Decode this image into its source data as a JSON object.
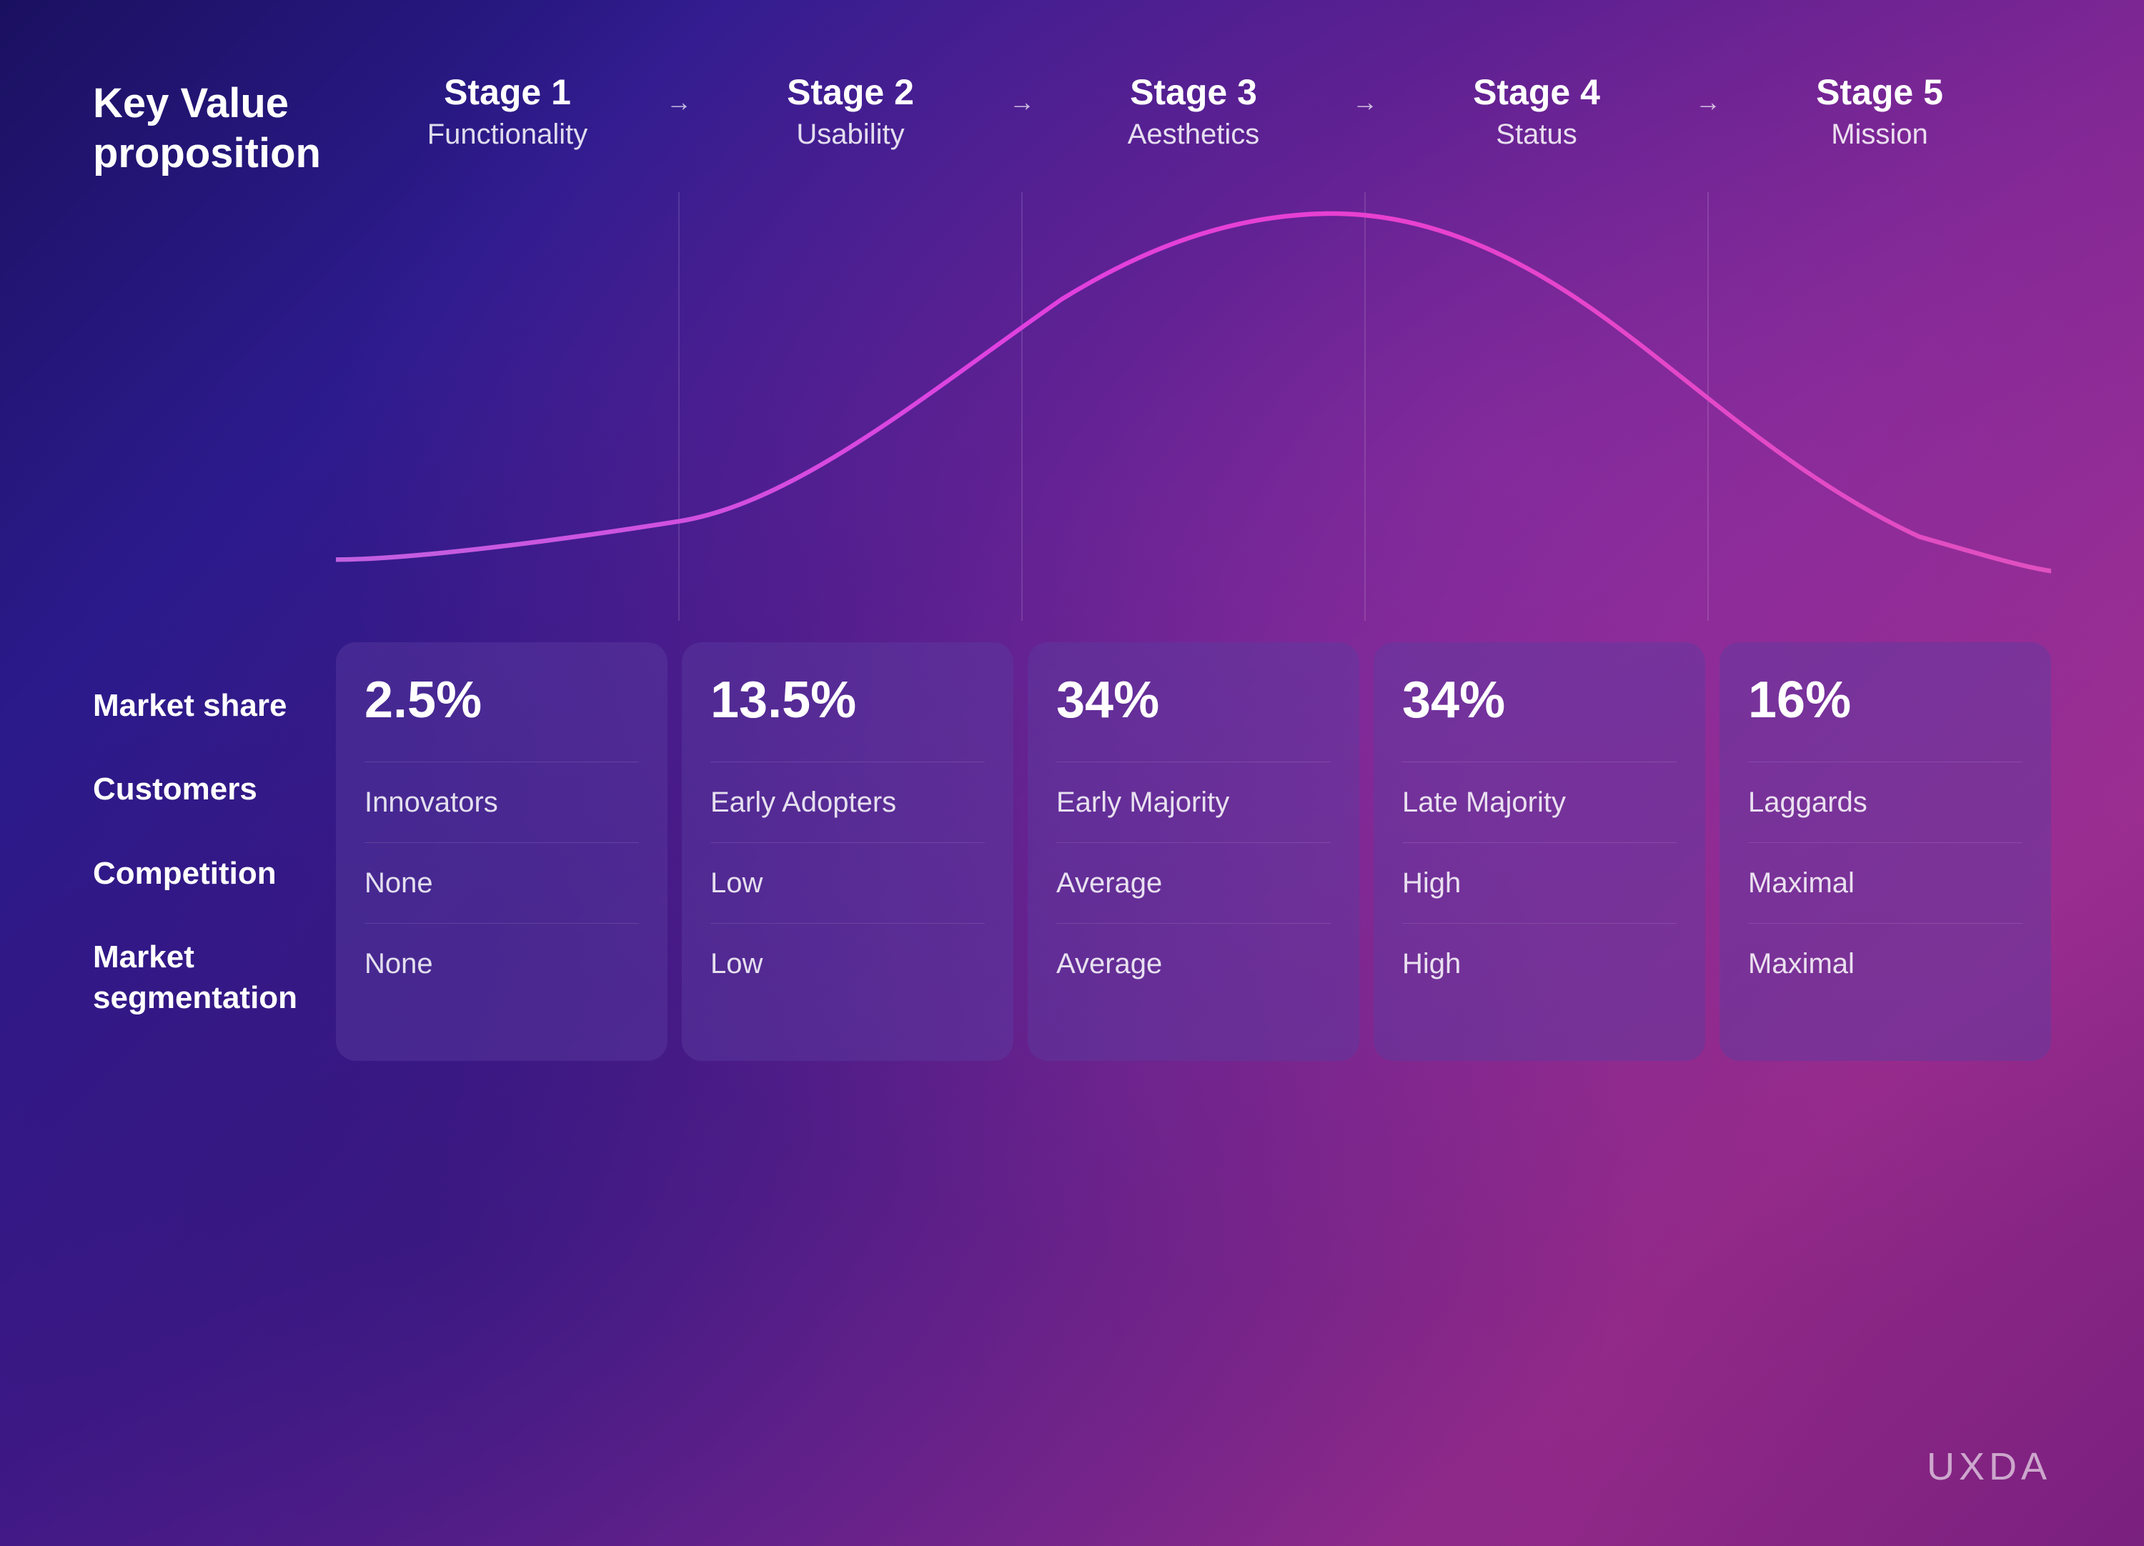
{
  "title": "Key Value proposition",
  "stages": [
    {
      "number": "Stage 1",
      "subtitle": "Functionality",
      "arrow": true
    },
    {
      "number": "Stage 2",
      "subtitle": "Usability",
      "arrow": true
    },
    {
      "number": "Stage 3",
      "subtitle": "Aesthetics",
      "arrow": true
    },
    {
      "number": "Stage 4",
      "subtitle": "Status",
      "arrow": true
    },
    {
      "number": "Stage 5",
      "subtitle": "Mission",
      "arrow": false
    }
  ],
  "row_labels": [
    "Market share",
    "Customers",
    "Competition",
    "Market segmentation"
  ],
  "data_cols": [
    {
      "market_share": "2.5%",
      "customers": "Innovators",
      "competition": "None",
      "market_segmentation": "None"
    },
    {
      "market_share": "13.5%",
      "customers": "Early Adopters",
      "competition": "Low",
      "market_segmentation": "Low"
    },
    {
      "market_share": "34%",
      "customers": "Early Majority",
      "competition": "Average",
      "market_segmentation": "Average"
    },
    {
      "market_share": "34%",
      "customers": "Late Majority",
      "competition": "High",
      "market_segmentation": "High"
    },
    {
      "market_share": "16%",
      "customers": "Laggards",
      "competition": "Maximal",
      "market_segmentation": "Maximal"
    }
  ],
  "logo": "UXDA"
}
